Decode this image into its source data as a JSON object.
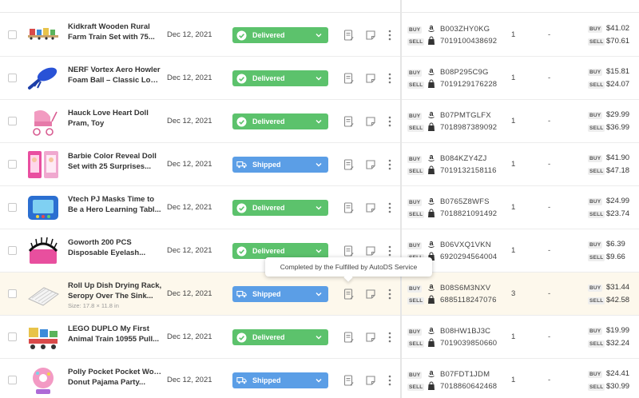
{
  "colors": {
    "delivered": "#5cc26c",
    "shipped": "#5b9ee6",
    "highlight_row": "#fdf8ec"
  },
  "labels": {
    "buy": "BUY",
    "sell": "SELL"
  },
  "tooltip": {
    "text": "Completed by the Fulfilled by AutoDS Service"
  },
  "orders": [
    {
      "title_line1": "Kidkraft Wooden Rural",
      "title_line2": "Farm Train Set with 75...",
      "date": "Dec 12, 2021",
      "status": "Delivered",
      "asin": "B003ZHY0KG",
      "barcode": "7019100438692",
      "qty": "1",
      "extra": "-",
      "buy_price": "$41.02",
      "sell_price": "$70.61",
      "thumb_icon": "train-set-thumb"
    },
    {
      "title_line1": "NERF Vortex Aero Howler",
      "title_line2": "Foam Ball – Classic Long...",
      "date": "Dec 12, 2021",
      "status": "Delivered",
      "asin": "B08P295C9G",
      "barcode": "7019129176228",
      "qty": "1",
      "extra": "-",
      "buy_price": "$15.81",
      "sell_price": "$24.07",
      "thumb_icon": "foam-ball-thumb"
    },
    {
      "title_line1": "Hauck Love Heart Doll",
      "title_line2": "Pram, Toy",
      "date": "Dec 12, 2021",
      "status": "Delivered",
      "asin": "B07PMTGLFX",
      "barcode": "7018987389092",
      "qty": "1",
      "extra": "-",
      "buy_price": "$29.99",
      "sell_price": "$36.99",
      "thumb_icon": "doll-pram-thumb"
    },
    {
      "title_line1": "Barbie Color Reveal Doll",
      "title_line2": "Set with 25 Surprises...",
      "date": "Dec 12, 2021",
      "status": "Shipped",
      "asin": "B084KZY4ZJ",
      "barcode": "7019132158116",
      "qty": "1",
      "extra": "-",
      "buy_price": "$41.90",
      "sell_price": "$47.18",
      "thumb_icon": "doll-box-thumb"
    },
    {
      "title_line1": "Vtech PJ Masks Time to",
      "title_line2": "Be a Hero Learning Tabl...",
      "date": "Dec 12, 2021",
      "status": "Delivered",
      "asin": "B0765Z8WFS",
      "barcode": "7018821091492",
      "qty": "1",
      "extra": "-",
      "buy_price": "$24.99",
      "sell_price": "$23.74",
      "thumb_icon": "tablet-thumb"
    },
    {
      "title_line1": "Goworth 200 PCS",
      "title_line2": "Disposable Eyelash...",
      "date": "Dec 12, 2021",
      "status": "Delivered",
      "asin": "B06VXQ1VKN",
      "barcode": "6920294564004",
      "qty": "1",
      "extra": "-",
      "buy_price": "$6.39",
      "sell_price": "$9.66",
      "thumb_icon": "eyelash-thumb"
    },
    {
      "title_line1": "Roll Up Dish Drying Rack,",
      "title_line2": "Seropy Over The Sink...",
      "size_note": "Size: 17.8 × 11.8 in",
      "date": "Dec 12, 2021",
      "status": "Shipped",
      "asin": "B08S6M3NXV",
      "barcode": "6885118247076",
      "qty": "3",
      "extra": "-",
      "buy_price": "$31.44",
      "sell_price": "$42.58",
      "thumb_icon": "drying-rack-thumb"
    },
    {
      "title_line1": "LEGO DUPLO My First",
      "title_line2": "Animal Train 10955 Pull...",
      "date": "Dec 12, 2021",
      "status": "Delivered",
      "asin": "B08HW1BJ3C",
      "barcode": "7019039850660",
      "qty": "1",
      "extra": "-",
      "buy_price": "$19.99",
      "sell_price": "$32.24",
      "thumb_icon": "lego-train-thumb"
    },
    {
      "title_line1": "Polly Pocket Pocket World",
      "title_line2": "Donut Pajama Party...",
      "date": "Dec 12, 2021",
      "status": "Shipped",
      "asin": "B07FDT1JDM",
      "barcode": "7018860642468",
      "qty": "1",
      "extra": "-",
      "buy_price": "$24.41",
      "sell_price": "$30.99",
      "thumb_icon": "polly-pocket-thumb"
    }
  ]
}
